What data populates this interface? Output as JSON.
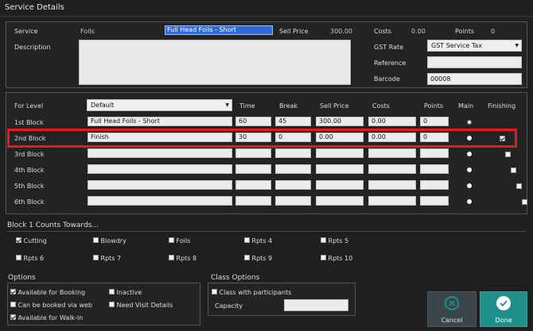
{
  "window": {
    "title": "Service Details"
  },
  "service": {
    "service_label": "Service",
    "category": "Foils",
    "name": "Full Head Foils - Short",
    "sell_price_label": "Sell Price",
    "sell_price": "300.00",
    "costs_label": "Costs",
    "costs": "0.00",
    "points_label": "Points",
    "points": "0",
    "description_label": "Description",
    "description": "",
    "gst_rate_label": "GST Rate",
    "gst_rate": "GST Service Tax",
    "reference_label": "Reference",
    "reference": "",
    "barcode_label": "Barcode",
    "barcode": "00008"
  },
  "levels": {
    "for_level_label": "For Level",
    "for_level": "Default",
    "headers": {
      "time": "Time",
      "break": "Break",
      "sell_price": "Sell Price",
      "costs": "Costs",
      "points": "Points",
      "main": "Main",
      "finishing": "Finishing"
    },
    "rows": [
      {
        "label": "1st Block",
        "name": "Full Head Foils - Short",
        "time": "60",
        "break": "45",
        "sell_price": "300.00",
        "costs": "0.00",
        "points": "0",
        "main": true,
        "finishing": false,
        "finishing_shown": false
      },
      {
        "label": "2nd Block",
        "name": "Finish",
        "time": "30",
        "break": "0",
        "sell_price": "0.00",
        "costs": "0.00",
        "points": "0",
        "main": false,
        "finishing": true,
        "finishing_shown": true
      },
      {
        "label": "3rd Block",
        "name": "",
        "time": "",
        "break": "",
        "sell_price": "",
        "costs": "",
        "points": "",
        "main": false,
        "finishing": false,
        "finishing_shown": true
      },
      {
        "label": "4th Block",
        "name": "",
        "time": "",
        "break": "",
        "sell_price": "",
        "costs": "",
        "points": "",
        "main": false,
        "finishing": false,
        "finishing_shown": true
      },
      {
        "label": "5th Block",
        "name": "",
        "time": "",
        "break": "",
        "sell_price": "",
        "costs": "",
        "points": "",
        "main": false,
        "finishing": false,
        "finishing_shown": true
      },
      {
        "label": "6th Block",
        "name": "",
        "time": "",
        "break": "",
        "sell_price": "",
        "costs": "",
        "points": "",
        "main": false,
        "finishing": false,
        "finishing_shown": true
      }
    ]
  },
  "counts": {
    "title": "Block 1 Counts Towards...",
    "items": [
      {
        "label": "Cutting",
        "checked": true
      },
      {
        "label": "Blowdry",
        "checked": false
      },
      {
        "label": "Foils",
        "checked": false
      },
      {
        "label": "Rpts 4",
        "checked": false
      },
      {
        "label": "Rpts 5",
        "checked": false
      },
      {
        "label": "Rpts 6",
        "checked": false
      },
      {
        "label": "Rpts 7",
        "checked": false
      },
      {
        "label": "Rpts 8",
        "checked": false
      },
      {
        "label": "Rpts 9",
        "checked": false
      },
      {
        "label": "Rpts 10",
        "checked": false
      }
    ]
  },
  "options": {
    "title": "Options",
    "available_booking": {
      "label": "Available for Booking",
      "checked": true
    },
    "inactive": {
      "label": "Inactive",
      "checked": false
    },
    "booked_web": {
      "label": "Can be booked via web",
      "checked": false
    },
    "need_visit": {
      "label": "Need Visit Details",
      "checked": false
    },
    "walk_in": {
      "label": "Available for Walk-in",
      "checked": true
    }
  },
  "class_options": {
    "title": "Class Options",
    "with_participants": {
      "label": "Class with participants",
      "checked": false
    },
    "capacity_label": "Capacity",
    "capacity": ""
  },
  "buttons": {
    "cancel": "Cancel",
    "done": "Done"
  },
  "colors": {
    "highlight": "#e51b1b",
    "done": "#1f8f8a",
    "cancel": "#3a4649"
  }
}
